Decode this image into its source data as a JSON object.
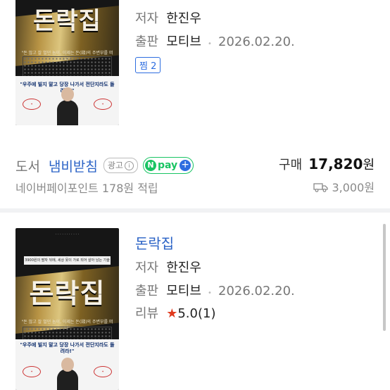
{
  "item1": {
    "cover_title": "돈락집",
    "cover_tagline": "\"돈 많고 잘 벌던 놈이, 이제는 돈(錢)의 주변부를 떠나\"",
    "cover_quote": "\"우주에 빌지 말고 당장 나가서 전단지라도 돌려라!\"",
    "author_label": "저자",
    "author": "한진우",
    "publisher_label": "출판",
    "publisher": "모티브",
    "date": "2026.02.20.",
    "jjim_label": "찜 2"
  },
  "seller": {
    "category": "도서",
    "store_name": "냄비받침",
    "ad_label": "광고",
    "ad_info_icon": "i",
    "npay_n": "N",
    "npay_label": "pay",
    "npay_plus": "+",
    "buy_label": "구매",
    "price": "17,820",
    "price_unit": "원",
    "points_text": "네이버페이포인트 178원 적립",
    "shipping": "3,000원"
  },
  "item2": {
    "title": "돈락집",
    "cover_title": "돈락집",
    "cover_subtitle": "3900원의 팔자 뒤에, 세상 못이 가로 되어 살아 남는 기술",
    "cover_tagline": "\"돈 많고 잘 벌던 놈이, 이제는 돈(錢)의 주변부를 떠나\"",
    "cover_quote": "\"우주에 빌지 말고 당장 나가서 전단지라도 돌려라!\"",
    "author_label": "저자",
    "author": "한진우",
    "publisher_label": "출판",
    "publisher": "모티브",
    "date": "2026.02.20.",
    "review_label": "리뷰",
    "rating": "5.0",
    "review_count": "(1)"
  },
  "colors": {
    "link_blue": "#2a62c6",
    "npay_green": "#19c463",
    "star_red": "#e03a1e"
  }
}
